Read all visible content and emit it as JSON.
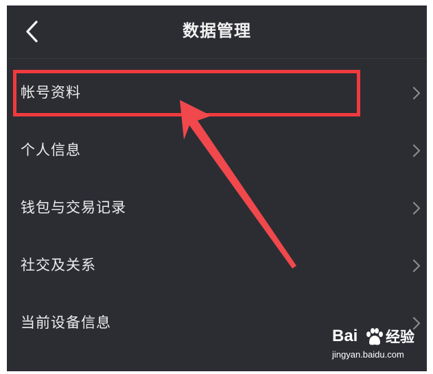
{
  "header": {
    "title": "数据管理",
    "back_icon": "chevron-left-icon"
  },
  "menu": {
    "items": [
      {
        "label": "帐号资料",
        "icon": "chevron-right-icon",
        "highlighted": true
      },
      {
        "label": "个人信息",
        "icon": "chevron-right-icon"
      },
      {
        "label": "钱包与交易记录",
        "icon": "chevron-right-icon"
      },
      {
        "label": "社交及关系",
        "icon": "chevron-right-icon"
      },
      {
        "label": "当前设备信息",
        "icon": "chevron-right-icon"
      }
    ]
  },
  "annotation": {
    "highlight_color": "#f03a3e",
    "arrow_color": "#f0484c"
  },
  "watermark": {
    "brand": "Bai",
    "brand_suffix": "经验",
    "url": "jingyan.baidu.com"
  },
  "colors": {
    "background": "#2c2d33",
    "text": "#ececec",
    "chevron": "#8a8b91"
  }
}
